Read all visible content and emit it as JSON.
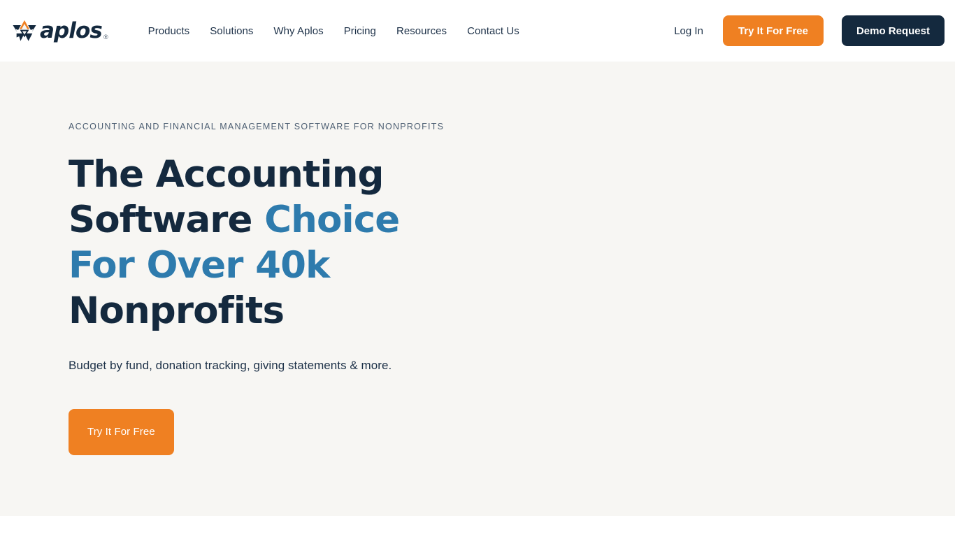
{
  "brand": {
    "name": "aplos",
    "registered_mark": "®",
    "logo_icon": "aplos-pinwheel-logo",
    "navy": "#14293E",
    "orange": "#EF8022",
    "accent_blue": "#2E7BAD",
    "hero_background": "#F7F6F3"
  },
  "header": {
    "nav_items": [
      {
        "label": "Products"
      },
      {
        "label": "Solutions"
      },
      {
        "label": "Why Aplos"
      },
      {
        "label": "Pricing"
      },
      {
        "label": "Resources"
      },
      {
        "label": "Contact Us"
      }
    ],
    "login_label": "Log In",
    "try_free_label": "Try It For Free",
    "demo_request_label": "Demo Request"
  },
  "hero": {
    "eyebrow": "ACCOUNTING AND FINANCIAL MANAGEMENT SOFTWARE FOR NONPROFITS",
    "title_part1": "The Accounting Software ",
    "title_accent": "Choice For Over 40k",
    "title_part2": " Nonprofits",
    "subtitle": "Budget by fund, donation tracking, giving statements & more.",
    "cta_label": "Try It For Free"
  }
}
